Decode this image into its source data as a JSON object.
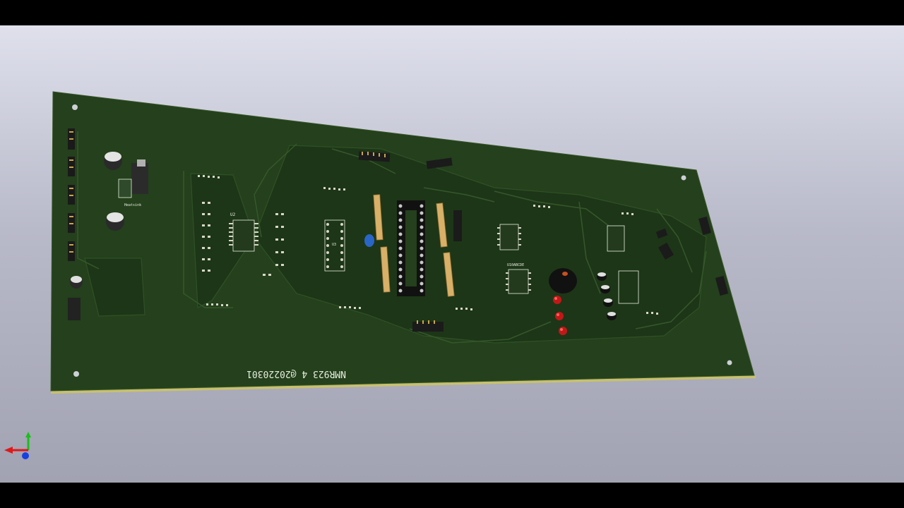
{
  "viewer": {
    "board_text": "NMR923 4 @20220301",
    "board_color": "#24401c",
    "background_top": "#dfe0ec",
    "background_bottom": "#a1a2b2"
  },
  "silkscreen": {
    "u2": "U2",
    "u3": "U3",
    "heatsink": "Heatsink",
    "dip_top": "W10",
    "chip_label": "U10ABCDE"
  },
  "axis_gizmo": {
    "x_color": "#e01818",
    "y_color": "#18c018",
    "z_color": "#1840e0"
  }
}
